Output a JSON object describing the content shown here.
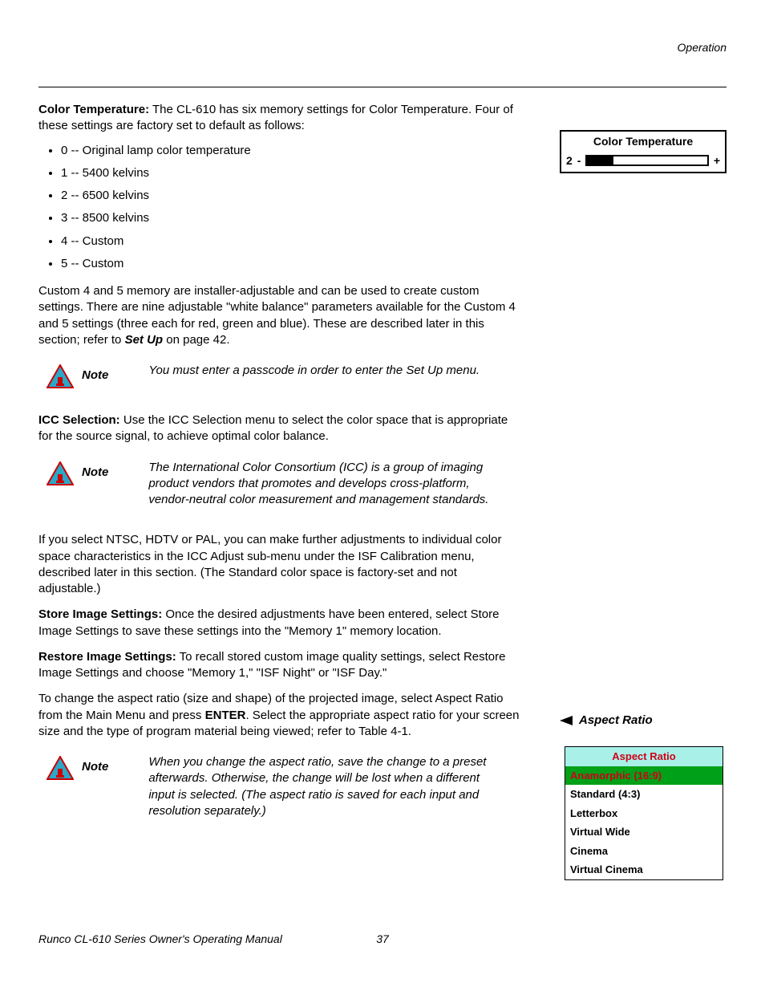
{
  "header": "Operation",
  "ct_heading": "Color Temperature:",
  "ct_intro": " The CL-610 has six memory settings for Color Temperature. Four of these settings are factory set to default as follows:",
  "ct_list": [
    "0 -- Original lamp color temperature",
    "1 -- 5400 kelvins",
    "2 -- 6500 kelvins",
    "3 -- 8500 kelvins",
    "4 -- Custom",
    "5 -- Custom"
  ],
  "ct_para2a": "Custom 4 and 5 memory are installer-adjustable and can be used to create custom settings. There are nine adjustable \"white balance\" parameters available for the Custom 4 and 5 settings (three each for red, green and blue). These are described later in this section; refer to ",
  "ct_para2_link": "Set Up",
  "ct_para2b": " on page 42.",
  "note_label": "Note",
  "note1": "You must enter a passcode in order to enter the Set Up menu.",
  "icc_heading": "ICC Selection:",
  "icc_text": " Use the ICC Selection menu to select the color space that is appropriate for the source signal, to achieve optimal color balance.",
  "note2": "The International Color Consortium (ICC) is a group of imaging product vendors that promotes and develops cross-platform, vendor-neutral color measurement and management standards.",
  "icc_para2": "If you select NTSC, HDTV or PAL, you can make further adjustments to individual color space characteristics in the ICC Adjust sub-menu under the ISF Calibration menu, described later in this section. (The Standard color space is factory-set and not adjustable.)",
  "store_heading": "Store Image Settings:",
  "store_text": " Once the desired adjustments have been entered, select Store Image Settings to save these settings into the \"Memory 1\" memory location.",
  "restore_heading": "Restore Image Settings:",
  "restore_text": " To recall stored custom image quality settings, select Restore Image Settings and choose \"Memory 1,\" \"ISF Night\" or \"ISF Day.\"",
  "aspect_para_a": "To change the aspect ratio (size and shape) of the projected image, select Aspect Ratio from the Main Menu and press ",
  "enter_label": "ENTER",
  "aspect_para_b": ". Select the appropriate aspect ratio for your screen size and the type of program material being viewed; refer to Table 4-1.",
  "note3": "When you change the aspect ratio, save the change to a preset afterwards. Otherwise, the change will be lost when a different input is selected. (The aspect ratio is saved for each input and resolution separately.)",
  "sidebar": {
    "ct_title": "Color Temperature",
    "ct_value": "2",
    "aspect_heading": "Aspect Ratio",
    "menu_title": "Aspect Ratio",
    "items": [
      "Anamorphic (16:9)",
      "Standard (4:3)",
      "Letterbox",
      "Virtual Wide",
      "Cinema",
      "Virtual Cinema"
    ]
  },
  "footer_left": "Runco CL-610 Series Owner's Operating Manual",
  "footer_page": "37"
}
